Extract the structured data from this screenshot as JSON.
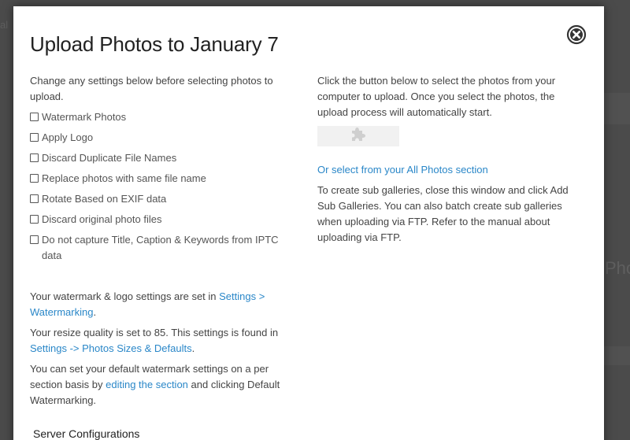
{
  "background": {
    "fragment_left": "al",
    "fragment_right": "Pho"
  },
  "modal": {
    "title": "Upload Photos to January 7",
    "close_icon": "close-circle-icon"
  },
  "left": {
    "intro": "Change any settings below before selecting photos to upload.",
    "options": [
      {
        "label": "Watermark Photos",
        "checked": false
      },
      {
        "label": "Apply Logo",
        "checked": false
      },
      {
        "label": "Discard Duplicate File Names",
        "checked": false
      },
      {
        "label": "Replace photos with same file name",
        "checked": false
      },
      {
        "label": "Rotate Based on EXIF data",
        "checked": false
      },
      {
        "label": "Discard original photo files",
        "checked": false
      },
      {
        "label": "Do not capture Title, Caption & Keywords from IPTC data",
        "checked": false
      }
    ],
    "note1_text": "Your watermark & logo settings are set in ",
    "note1_link": "Settings > Watermarking",
    "note1_end": ".",
    "note2_text": "Your resize quality is set to 85. This settings is found in ",
    "note2_link": "Settings -> Photos Sizes & Defaults",
    "note2_end": ".",
    "note3_text": "You can set your default watermark settings on a per section basis by ",
    "note3_link": "editing the section",
    "note3_end": " and clicking Default Watermarking.",
    "server_heading": "Server Configurations"
  },
  "right": {
    "intro": "Click the button below to select the photos from your computer to upload. Once you select the photos, the upload process will automatically start.",
    "upload_button_icon": "puzzle-plugin-icon",
    "select_link": "Or select from your All Photos section",
    "sub_galleries": "To create sub galleries, close this window and click Add Sub Galleries. You can also batch create sub galleries when uploading via FTP. Refer to the manual about uploading via FTP."
  },
  "colors": {
    "link": "#2a87c8",
    "overlay": "#4b4b4b",
    "button_bg": "#f1f1f1"
  }
}
